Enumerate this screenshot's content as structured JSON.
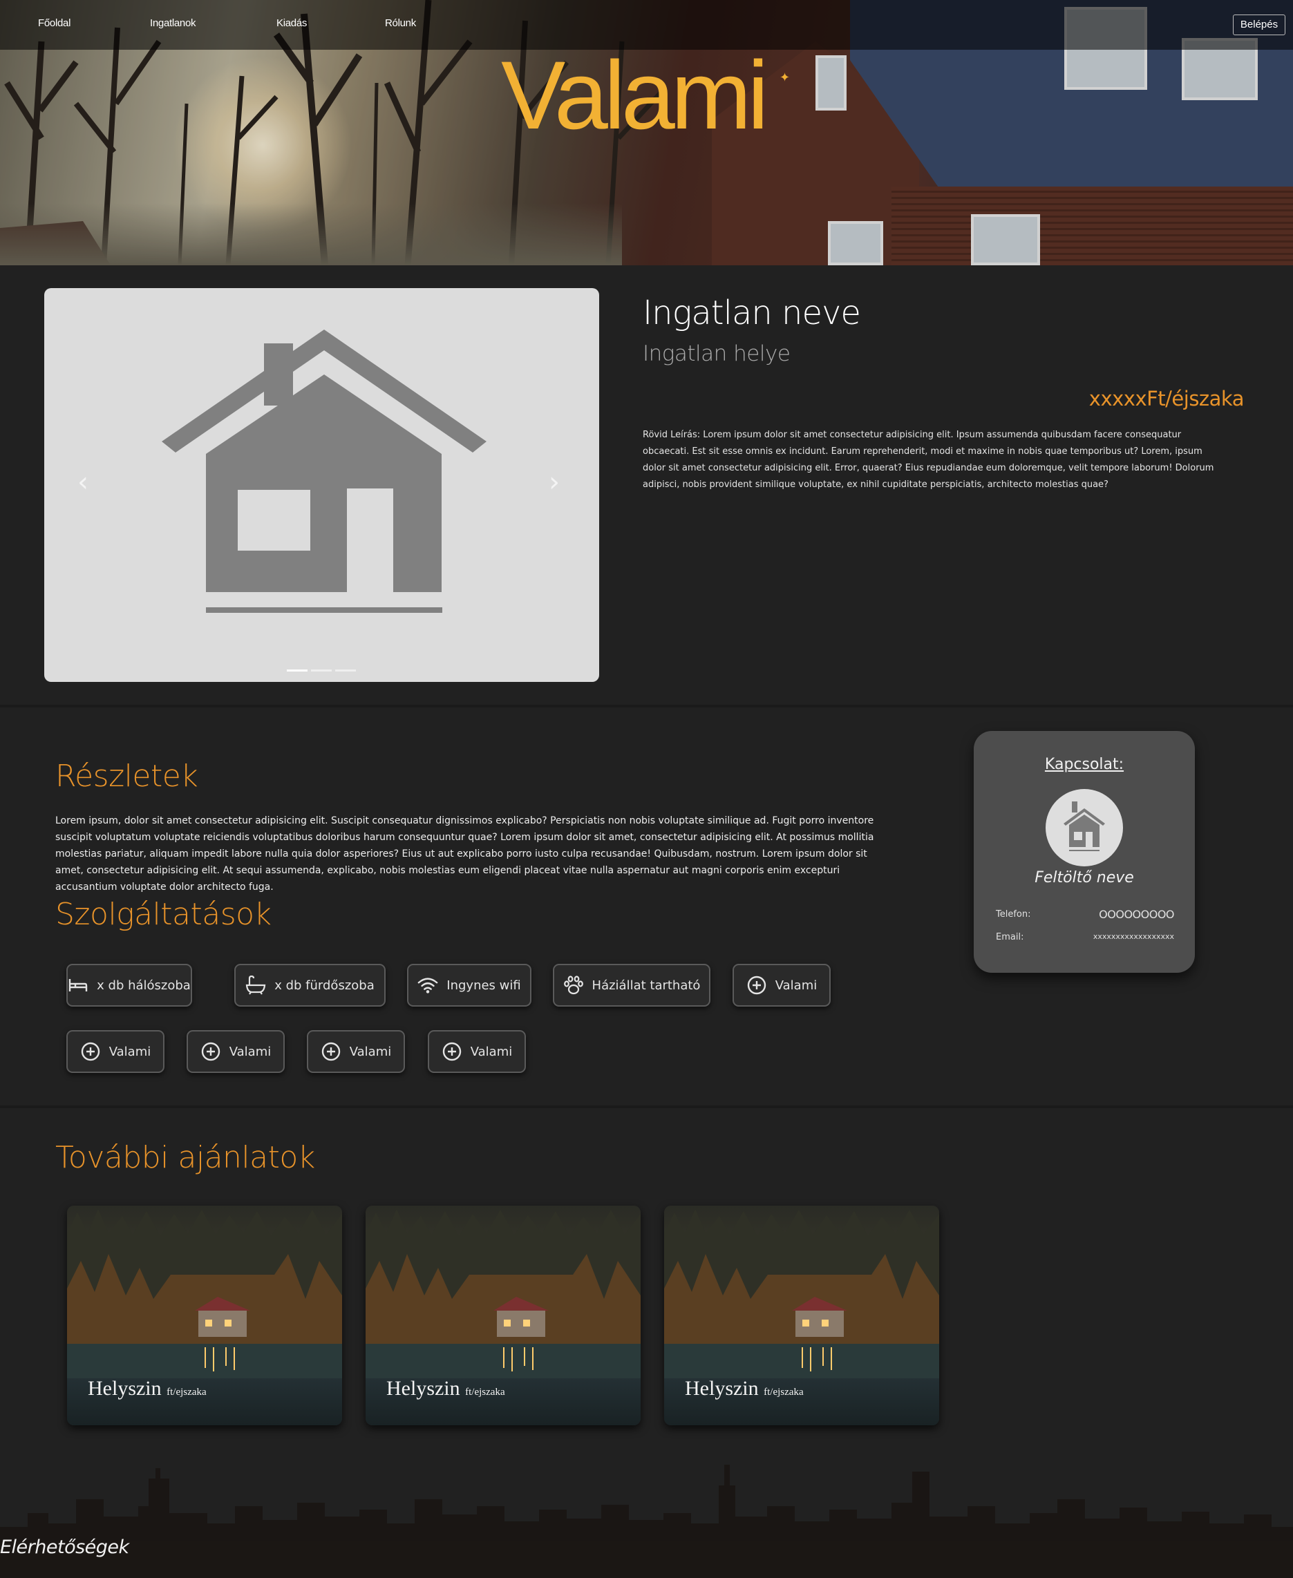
{
  "nav": {
    "items": [
      "Főoldal",
      "Ingatlanok",
      "Kiadás",
      "Rólunk"
    ],
    "login": "Belépés"
  },
  "brand": "Valami",
  "property": {
    "name": "Ingatlan neve",
    "location": "Ingatlan helye",
    "price": "xxxxxFt/éjszaka",
    "description": "Rövid Leírás: Lorem ipsum dolor sit amet consectetur adipisicing elit. Ipsum assumenda quibusdam facere consequatur obcaecati. Est sit esse omnis ex incidunt. Earum reprehenderit, modi et maxime in nobis quae temporibus ut? Lorem, ipsum dolor sit amet consectetur adipisicing elit. Error, quaerat? Eius repudiandae eum doloremque, velit tempore laborum! Dolorum adipisci, nobis provident similique voluptate, ex nihil cupiditate perspiciatis, architecto molestias quae?",
    "carousel": {
      "prev": "‹",
      "next": "›",
      "slides": 3,
      "active_slide": 1
    }
  },
  "details": {
    "heading": "Részletek",
    "text": "Lorem ipsum, dolor sit amet consectetur adipisicing elit. Suscipit consequatur dignissimos explicabo? Perspiciatis non nobis voluptate similique ad. Fugit porro inventore suscipit voluptatum voluptate reiciendis voluptatibus doloribus harum consequuntur quae? Lorem ipsum dolor sit amet, consectetur adipisicing elit. At possimus mollitia molestias pariatur, aliquam impedit labore nulla quia dolor asperiores? Eius ut aut explicabo porro iusto culpa recusandae! Quibusdam, nostrum. Lorem ipsum dolor sit amet, consectetur adipisicing elit. At sequi assumenda, explicabo, nobis molestias eum eligendi placeat vitae nulla aspernatur aut magni corporis enim excepturi accusantium voluptate dolor architecto fuga."
  },
  "services": {
    "heading": "Szolgáltatások",
    "items": [
      {
        "label": "x db hálószoba",
        "icon": "bed-icon"
      },
      {
        "label": "x db fürdőszoba",
        "icon": "bathtub-icon"
      },
      {
        "label": "Ingynes wifi",
        "icon": "wifi-icon"
      },
      {
        "label": "Háziállat tartható",
        "icon": "paw-icon"
      },
      {
        "label": "Valami",
        "icon": "plus-circle-icon"
      },
      {
        "label": "Valami",
        "icon": "plus-circle-icon"
      },
      {
        "label": "Valami",
        "icon": "plus-circle-icon"
      },
      {
        "label": "Valami",
        "icon": "plus-circle-icon"
      },
      {
        "label": "Valami",
        "icon": "plus-circle-icon"
      }
    ]
  },
  "contact": {
    "title": "Kapcsolat:",
    "uploader": "Feltöltő neve",
    "phone_label": "Telefon:",
    "phone": "OOOOOOOOO",
    "email_label": "Email:",
    "email": "xxxxxxxxxxxxxxxxxx"
  },
  "offers": {
    "heading": "További ajánlatok",
    "cards": [
      {
        "place": "Helyszin",
        "unit": "ft/ejszaka"
      },
      {
        "place": "Helyszin",
        "unit": "ft/ejszaka"
      },
      {
        "place": "Helyszin",
        "unit": "ft/ejszaka"
      }
    ]
  },
  "footer": {
    "title": "Elérhetőségek"
  },
  "colors": {
    "accent": "#e8932a",
    "brand": "#f2b134",
    "background": "#212121",
    "card": "#4d4d4d"
  }
}
